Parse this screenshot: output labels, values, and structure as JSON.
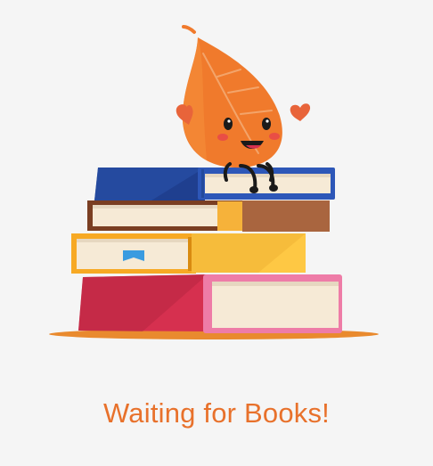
{
  "empty_state": {
    "message": "Waiting for Books!",
    "illustration_icon": "leaf-mascot-on-book-stack-icon"
  },
  "colors": {
    "background": "#f5f5f5",
    "accent": "#e8712b",
    "leaf": "#f07a2c",
    "heart": "#e8643a",
    "shadow": "#e98a2e",
    "book_blue": "#234a9c",
    "book_brown": "#a9653f",
    "book_yellow": "#f7b731",
    "book_red": "#d6304f",
    "book_pink": "#ee7ca7",
    "pages": "#f6ead6"
  }
}
